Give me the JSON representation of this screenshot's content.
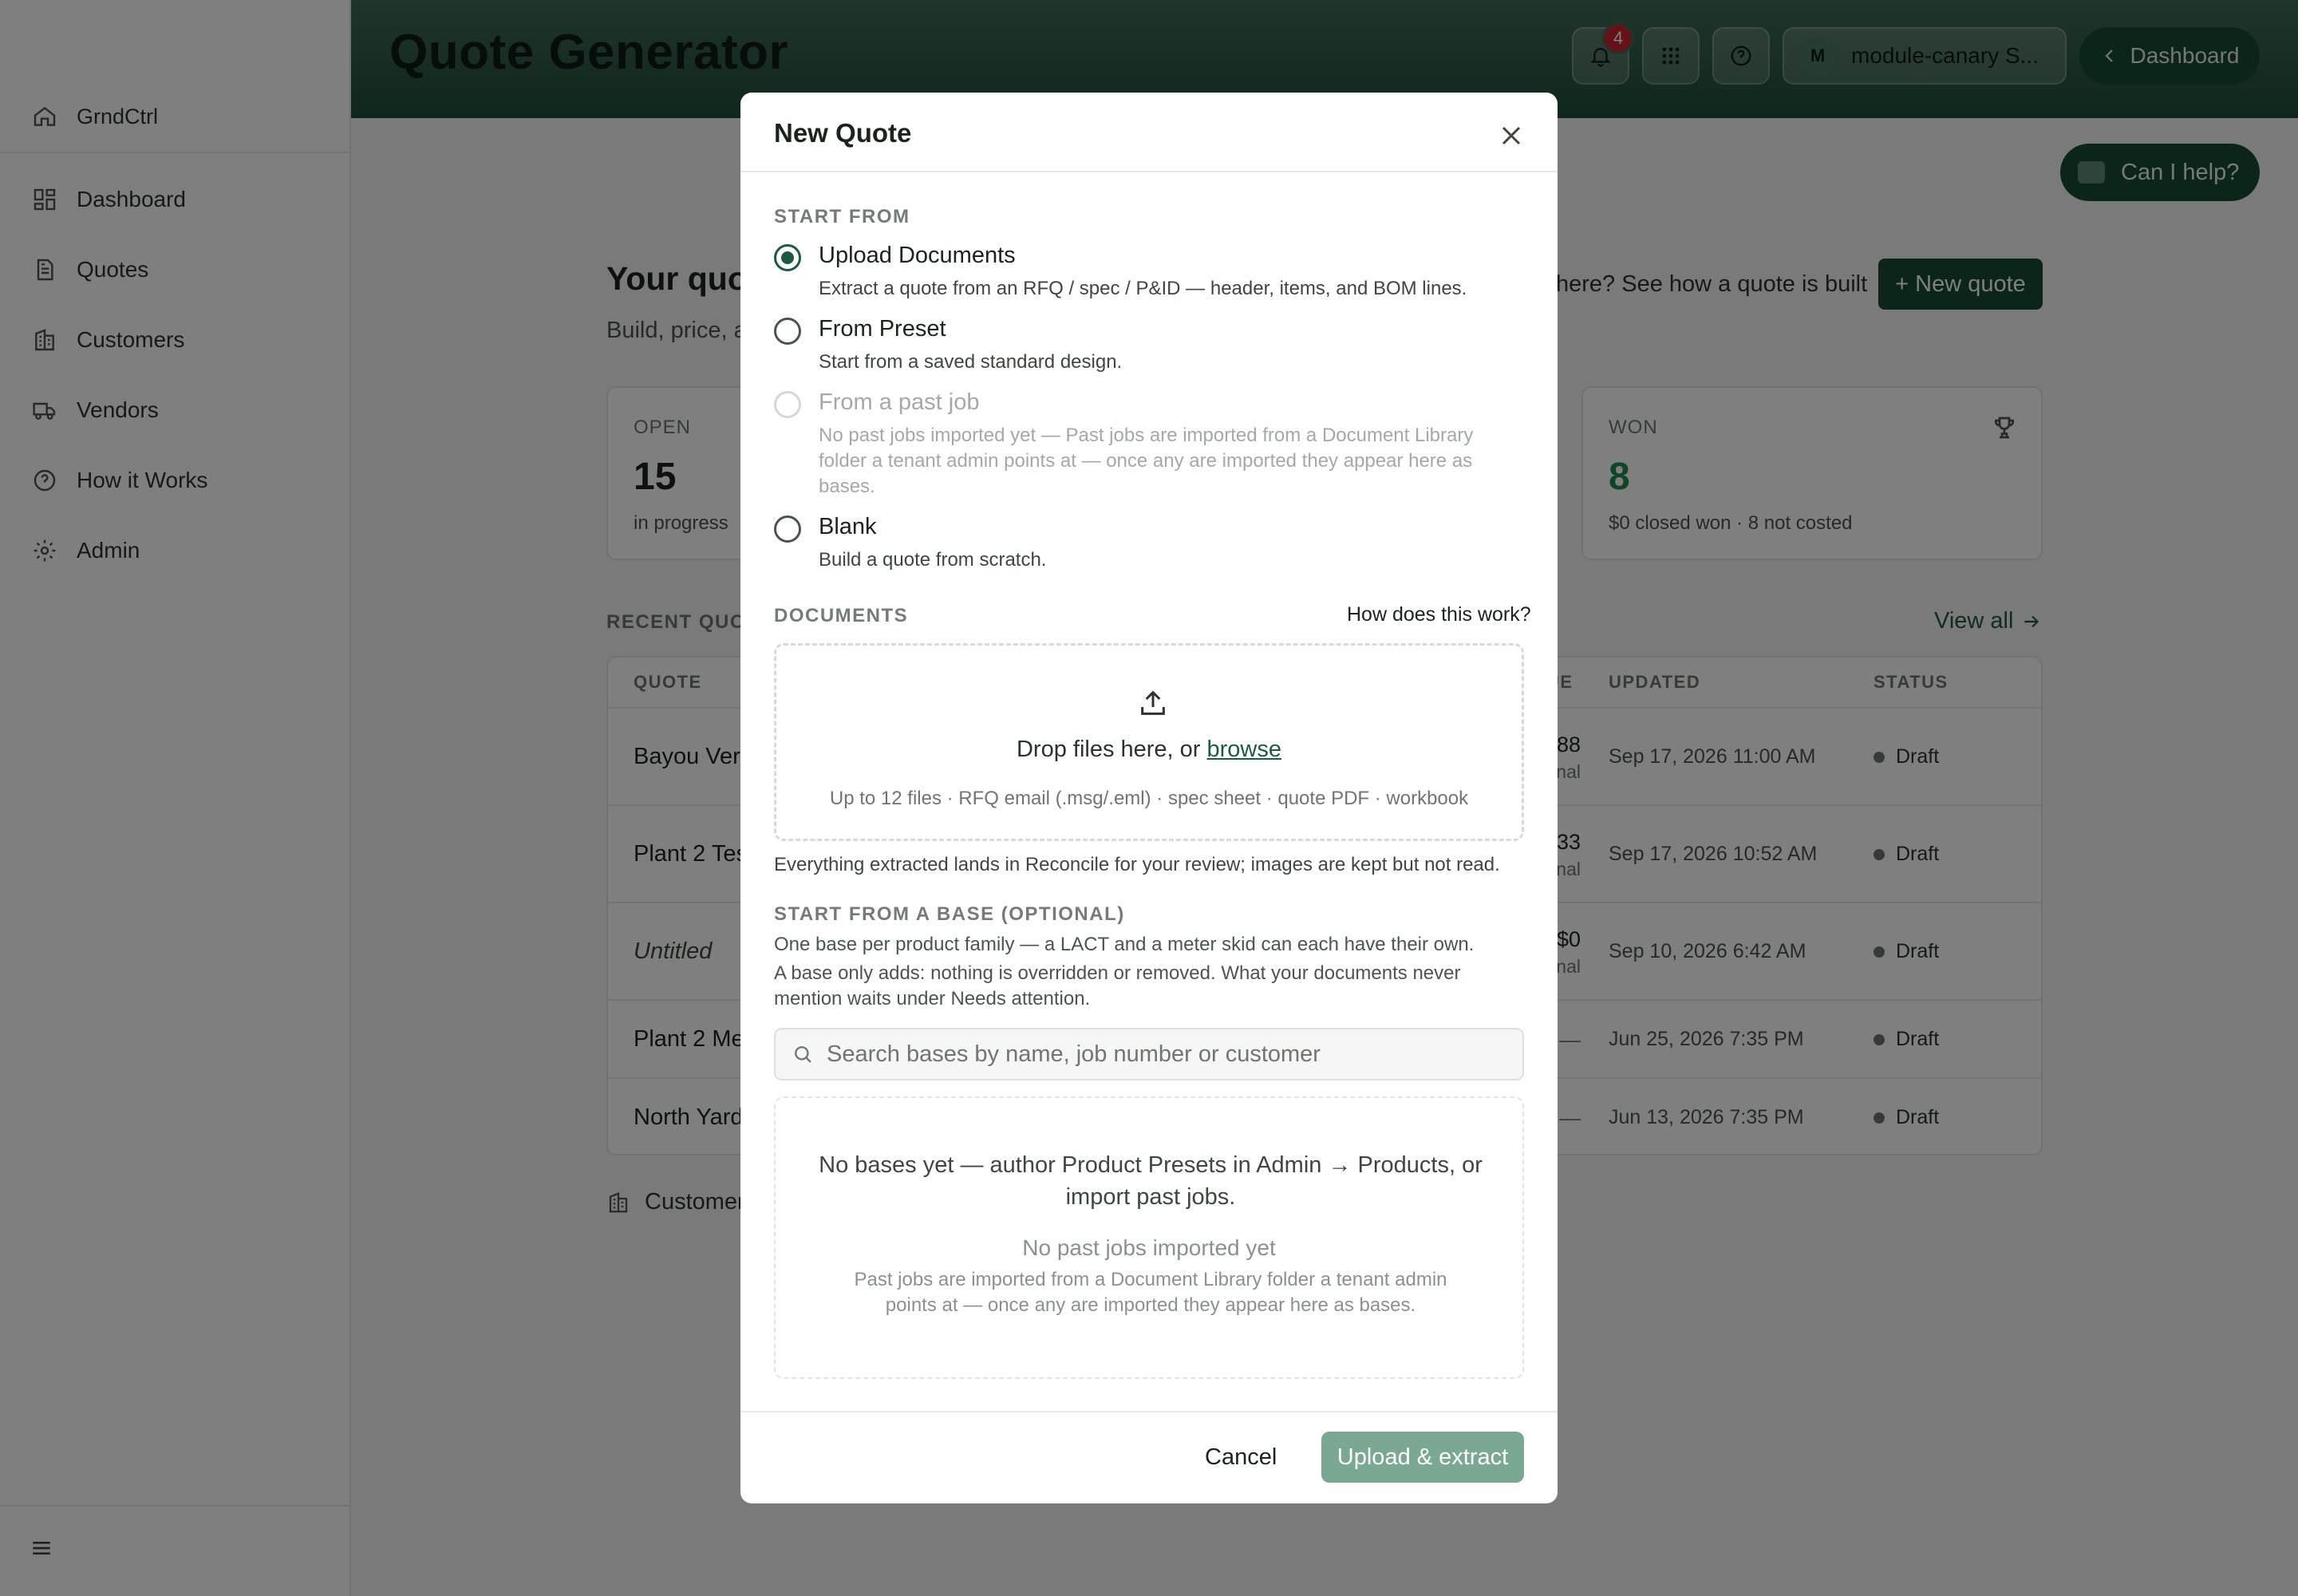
{
  "colors": {
    "accent": "#164a33",
    "accent_light": "#7aa892",
    "badge_red": "#c8242f",
    "won_green": "#1f8a4c"
  },
  "sidebar": {
    "brand": "GrndCtrl",
    "items": [
      {
        "label": "Dashboard",
        "icon": "dashboard-icon"
      },
      {
        "label": "Quotes",
        "icon": "document-icon"
      },
      {
        "label": "Customers",
        "icon": "building-icon"
      },
      {
        "label": "Vendors",
        "icon": "truck-icon"
      },
      {
        "label": "How it Works",
        "icon": "help-circle-icon"
      },
      {
        "label": "Admin",
        "icon": "gear-icon"
      }
    ]
  },
  "header": {
    "title": "Quote Generator",
    "notification_count": "4",
    "user_initial": "M",
    "user_name": "module-canary S...",
    "dashboard_button": "Dashboard"
  },
  "main": {
    "help_button": "Can I help?",
    "heading": "Your quo",
    "subheading": "Build, price, a",
    "see_how": "here? See how a quote is built",
    "new_quote_button": "+ New quote",
    "cards": [
      {
        "label": "OPEN",
        "value": "15",
        "note": "in progress"
      },
      {
        "label": "WON",
        "value": "8",
        "note": "$0 closed won · 8 not costed"
      }
    ],
    "recent_label": "RECENT QUO",
    "view_all": "View all",
    "columns": {
      "quote": "QUOTE",
      "value": "UE",
      "updated": "UPDATED",
      "status": "STATUS"
    },
    "rows": [
      {
        "quote": "Bayou Verd",
        "value": "88",
        "value_sub": "nal",
        "updated": "Sep 17, 2026 11:00 AM",
        "status": "Draft"
      },
      {
        "quote": "Plant 2 Tes",
        "value": "33",
        "value_sub": "nal",
        "updated": "Sep 17, 2026 10:52 AM",
        "status": "Draft"
      },
      {
        "quote": "Untitled",
        "value": "$0",
        "value_sub": "nal",
        "updated": "Sep 10, 2026 6:42 AM",
        "status": "Draft"
      },
      {
        "quote": "Plant 2 Me",
        "value": "—",
        "value_sub": "",
        "updated": "Jun 25, 2026 7:35 PM",
        "status": "Draft"
      },
      {
        "quote": "North Yard",
        "value": "—",
        "value_sub": "",
        "updated": "Jun 13, 2026 7:35 PM",
        "status": "Draft"
      }
    ],
    "customers_link": "Customer"
  },
  "modal": {
    "title": "New Quote",
    "start_from_label": "START FROM",
    "options": [
      {
        "title": "Upload Documents",
        "desc": "Extract a quote from an RFQ / spec / P&ID — header, items, and BOM lines.",
        "selected": true,
        "disabled": false
      },
      {
        "title": "From Preset",
        "desc": "Start from a saved standard design.",
        "selected": false,
        "disabled": false
      },
      {
        "title": "From a past job",
        "desc": "No past jobs imported yet — Past jobs are imported from a Document Library folder a tenant admin points at — once any are imported they appear here as bases.",
        "selected": false,
        "disabled": true
      },
      {
        "title": "Blank",
        "desc": "Build a quote from scratch.",
        "selected": false,
        "disabled": false
      }
    ],
    "documents_label": "DOCUMENTS",
    "how_link": "How does this work?",
    "drop_text": "Drop files here, or ",
    "browse_link": "browse",
    "drop_sub": "Up to 12 files · RFQ email (.msg/.eml) · spec sheet · quote PDF · workbook",
    "extract_note": "Everything extracted lands in Reconcile for your review; images are kept but not read.",
    "base_label": "START FROM A BASE (OPTIONAL)",
    "base_desc_1": "One base per product family — a LACT and a meter skid can each have their own.",
    "base_desc_2": "A base only adds: nothing is overridden or removed. What your documents never mention waits under Needs attention.",
    "search_placeholder": "Search bases by name, job number or customer",
    "empty_main": "No bases yet — author Product Presets in Admin → Products, or import past jobs.",
    "empty_sub": "No past jobs imported yet",
    "empty_desc": "Past jobs are imported from a Document Library folder a tenant admin points at — once any are imported they appear here as bases.",
    "cancel": "Cancel",
    "primary": "Upload & extract"
  }
}
